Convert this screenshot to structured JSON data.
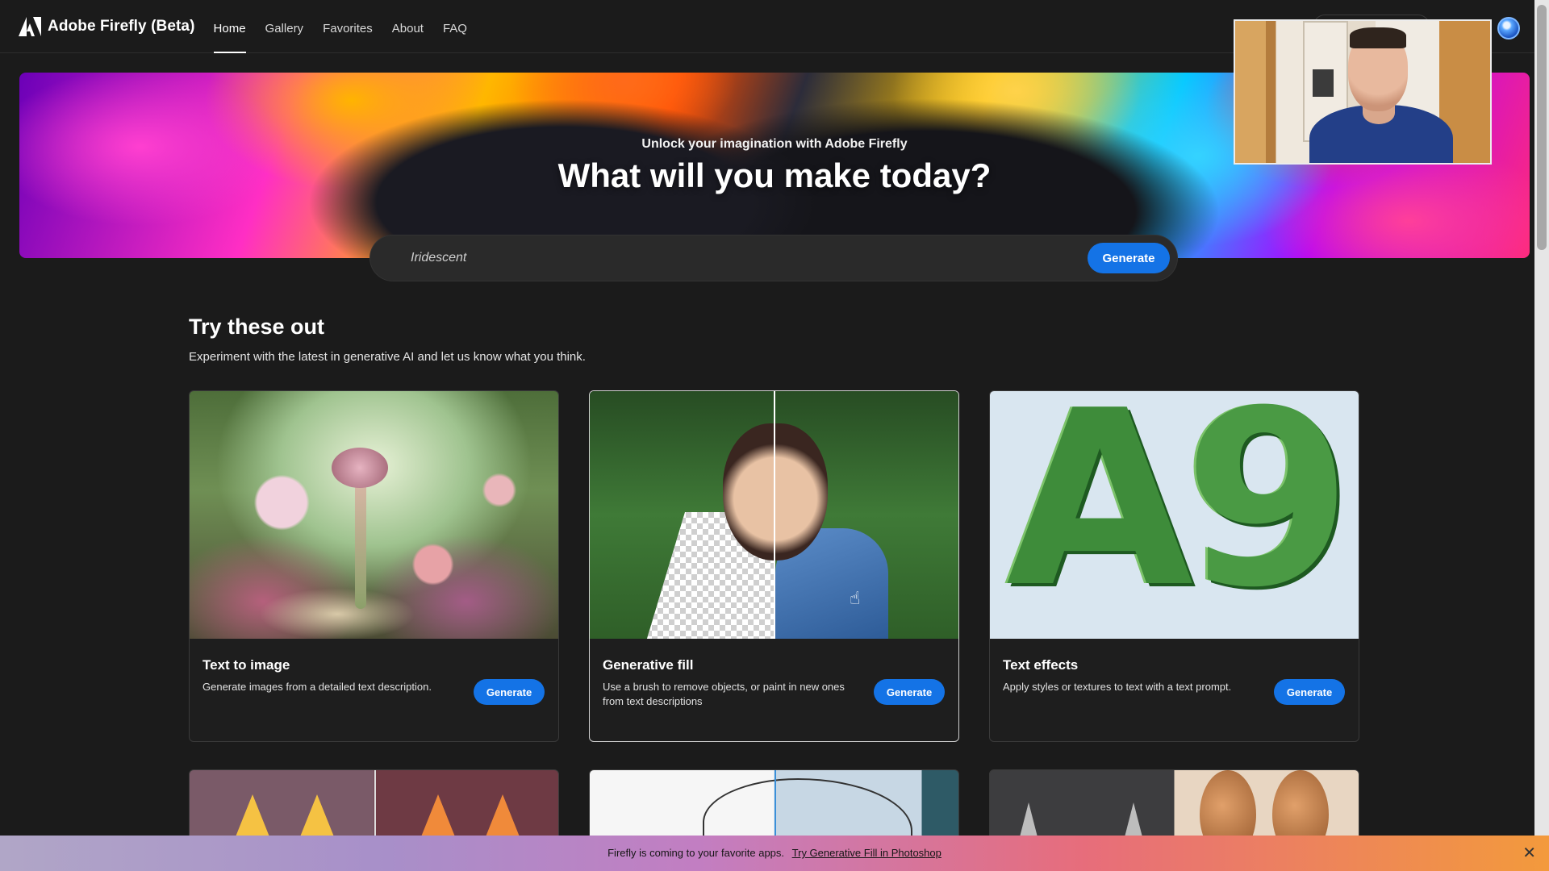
{
  "app": {
    "title": "Adobe Firefly (Beta)",
    "logo_icon": "adobe-icon"
  },
  "nav": {
    "items": [
      {
        "label": "Home",
        "active": true
      },
      {
        "label": "Gallery",
        "active": false
      },
      {
        "label": "Favorites",
        "active": false
      },
      {
        "label": "About",
        "active": false
      },
      {
        "label": "FAQ",
        "active": false
      }
    ]
  },
  "hero": {
    "subtitle": "Unlock your imagination with Adobe Firefly",
    "title": "What will you make today?"
  },
  "prompt": {
    "value": "Iridescent",
    "button_label": "Generate"
  },
  "section": {
    "title": "Try these out",
    "description": "Experiment with the latest in generative AI and let us know what you think."
  },
  "cards": [
    {
      "title": "Text to image",
      "description": "Generate images from a detailed text description.",
      "button_label": "Generate"
    },
    {
      "title": "Generative fill",
      "description": "Use a brush to remove objects, or paint in new ones from text descriptions",
      "button_label": "Generate"
    },
    {
      "title": "Text effects",
      "description": "Apply styles or textures to text with a text prompt.",
      "button_label": "Generate"
    }
  ],
  "text_effects_letters": [
    "A",
    "9"
  ],
  "banner": {
    "text": "Firefly is coming to your favorite apps.",
    "link_text": "Try Generative Fill in Photoshop",
    "close_icon": "close-icon"
  },
  "colors": {
    "accent": "#1473e6",
    "background": "#1b1b1b"
  }
}
